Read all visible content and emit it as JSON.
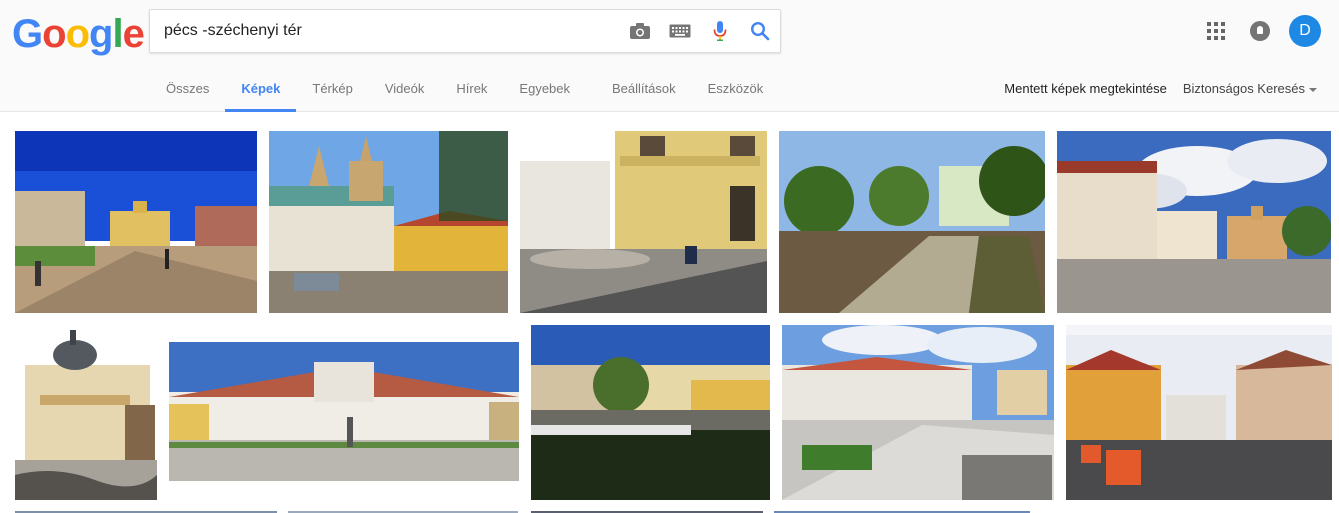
{
  "logo": {
    "letters": [
      "G",
      "o",
      "o",
      "g",
      "l",
      "e"
    ]
  },
  "search": {
    "query": "pécs -széchenyi tér"
  },
  "tabs": [
    {
      "label": "Összes"
    },
    {
      "label": "Képek"
    },
    {
      "label": "Térkép"
    },
    {
      "label": "Videók"
    },
    {
      "label": "Hírek"
    },
    {
      "label": "Egyebek"
    },
    {
      "label": "Beállítások"
    },
    {
      "label": "Eszközök"
    }
  ],
  "active_tab": "Képek",
  "toolbar": {
    "saved_images": "Mentett képek megtekintése",
    "safe_search": "Biztonságos Keresés"
  },
  "account": {
    "initial": "D"
  },
  "colors": {
    "blue": "#4285f4",
    "red": "#ea4335",
    "yellow": "#fbbc05",
    "green": "#34a853",
    "avatar": "#1e88e5"
  },
  "icons": [
    "camera-icon",
    "keyboard-icon",
    "microphone-icon",
    "search-icon",
    "apps-icon",
    "notifications-icon"
  ]
}
